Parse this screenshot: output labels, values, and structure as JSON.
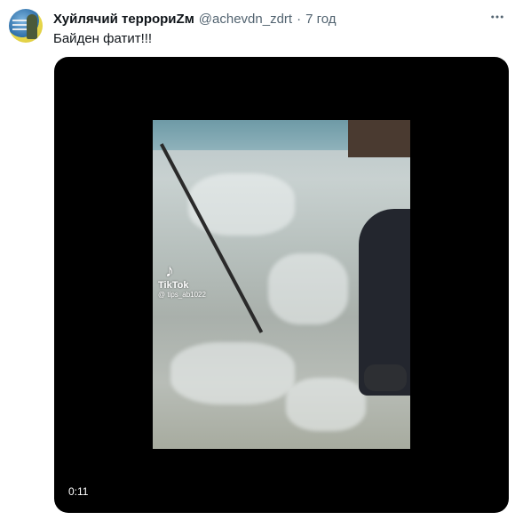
{
  "tweet": {
    "author_name": "Хуйлячий террориZм",
    "handle": "@achevdn_zdrt",
    "separator": "·",
    "time": "7 год",
    "text": "Байден фатит!!!"
  },
  "video": {
    "duration": "0:11",
    "watermark_brand": "TikTok",
    "watermark_user": "@ tips_ab1022"
  },
  "icons": {
    "more": "more-horizontal-icon",
    "tiktok": "tiktok-logo-icon"
  },
  "colors": {
    "text_primary": "#0f1419",
    "text_secondary": "#536471",
    "media_bg": "#000000"
  }
}
